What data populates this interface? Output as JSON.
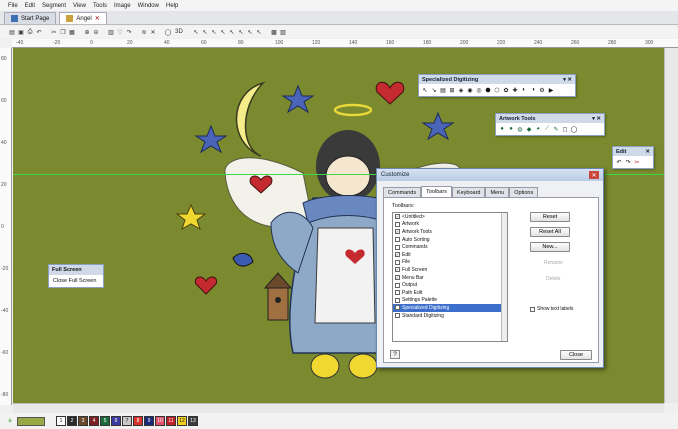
{
  "menu": [
    "File",
    "Edit",
    "Segment",
    "View",
    "Tools",
    "Image",
    "Window",
    "Help"
  ],
  "tabs": [
    {
      "label": "Start Page",
      "active": false
    },
    {
      "label": "Angel",
      "active": true
    }
  ],
  "toolbar_icons": [
    "open",
    "save",
    "print",
    "undo",
    "redo",
    "cut",
    "copy",
    "paste",
    "zoom-in",
    "zoom-out",
    "grid",
    "3d",
    "select",
    "node",
    "stitch",
    "fill",
    "satin",
    "run",
    "text",
    "applique",
    "trim",
    "color",
    "view"
  ],
  "ruler": {
    "h_labels": [
      "-40",
      "-20",
      "0",
      "20",
      "40",
      "60",
      "80",
      "100",
      "120",
      "140",
      "160",
      "180",
      "200",
      "220",
      "240",
      "260",
      "280",
      "300"
    ],
    "v_labels": [
      "80",
      "60",
      "40",
      "20",
      "0",
      "-20",
      "-40",
      "-60",
      "-80"
    ]
  },
  "colors": {
    "canvas": "#7b8a2e",
    "guide": "#3cd84a",
    "accent": "#3c6fcc"
  },
  "floating": {
    "specialized": {
      "title": "Specialized Digitizing"
    },
    "artwork": {
      "title": "Artwork Tools"
    },
    "edit": {
      "title": "Edit"
    }
  },
  "fullscreen_menu": {
    "title": "Full Screen",
    "item": "Close Full Screen"
  },
  "dialog": {
    "title": "Customize",
    "tabs": [
      "Commands",
      "Toolbars",
      "Keyboard",
      "Menu",
      "Options"
    ],
    "active_tab": "Toolbars",
    "toolbars_label": "Toolbars:",
    "items": [
      {
        "label": "<Untitled>",
        "checked": true,
        "selected": false
      },
      {
        "label": "Artwork",
        "checked": false,
        "selected": false
      },
      {
        "label": "Artwork Tools",
        "checked": true,
        "selected": false
      },
      {
        "label": "Auto Sorting",
        "checked": false,
        "selected": false
      },
      {
        "label": "Commands",
        "checked": false,
        "selected": false
      },
      {
        "label": "Edit",
        "checked": true,
        "selected": false
      },
      {
        "label": "File",
        "checked": false,
        "selected": false
      },
      {
        "label": "Full Screen",
        "checked": true,
        "selected": false
      },
      {
        "label": "Menu Bar",
        "checked": true,
        "selected": false
      },
      {
        "label": "Output",
        "checked": false,
        "selected": false
      },
      {
        "label": "Path Edit",
        "checked": false,
        "selected": false
      },
      {
        "label": "Settings Palette",
        "checked": false,
        "selected": false
      },
      {
        "label": "Specialized Digitizing",
        "checked": true,
        "selected": true
      },
      {
        "label": "Standard Digitizing",
        "checked": false,
        "selected": false
      }
    ],
    "buttons": {
      "reset": "Reset",
      "reset_all": "Reset All",
      "new": "New...",
      "rename": "Rename",
      "delete": "Delete",
      "close": "Close"
    },
    "show_text_labels": "Show text labels",
    "help": "?"
  },
  "status_swatches": [
    {
      "label": "1",
      "color": "#ffffff"
    },
    {
      "label": "2",
      "color": "#2b2b2b"
    },
    {
      "label": "3",
      "color": "#6b4a2b"
    },
    {
      "label": "4",
      "color": "#7d2020"
    },
    {
      "label": "5",
      "color": "#1b6c3c"
    },
    {
      "label": "6",
      "color": "#3a3aa0"
    },
    {
      "label": "7",
      "color": "#c8c8c8"
    },
    {
      "label": "8",
      "color": "#d8342c"
    },
    {
      "label": "9",
      "color": "#1a2a7a"
    },
    {
      "label": "10",
      "color": "#e0506a"
    },
    {
      "label": "11",
      "color": "#c02028"
    },
    {
      "label": "12",
      "color": "#f0d020"
    },
    {
      "label": "13",
      "color": "#3b3b3b"
    }
  ]
}
